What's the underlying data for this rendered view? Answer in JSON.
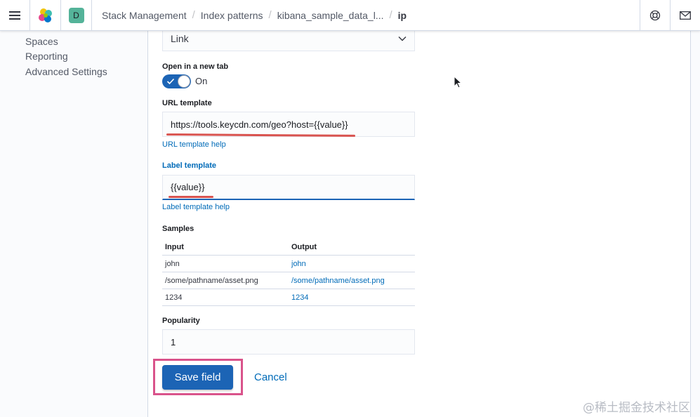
{
  "header": {
    "space_initial": "D",
    "breadcrumbs": [
      "Stack Management",
      "Index patterns",
      "kibana_sample_data_l...",
      "ip"
    ],
    "separator": "/"
  },
  "sidenav": {
    "items": [
      "Spaces",
      "Reporting",
      "Advanced Settings"
    ]
  },
  "form": {
    "select_value": "Link",
    "open_new_tab_label": "Open in a new tab",
    "open_new_tab_state": "On",
    "url_template_label": "URL template",
    "url_template_value": "https://tools.keycdn.com/geo?host={{value}}",
    "url_template_help": "URL template help",
    "label_template_label": "Label template",
    "label_template_value": "{{value}}",
    "label_template_help": "Label template help",
    "samples_label": "Samples",
    "samples_headers": [
      "Input",
      "Output"
    ],
    "samples_rows": [
      [
        "john",
        "john"
      ],
      [
        "/some/pathname/asset.png",
        "/some/pathname/asset.png"
      ],
      [
        "1234",
        "1234"
      ]
    ],
    "popularity_label": "Popularity",
    "popularity_value": "1",
    "save_label": "Save field",
    "cancel_label": "Cancel"
  },
  "watermark": "@稀土掘金技术社区",
  "colors": {
    "primary": "#1c64b5",
    "link": "#006bb8",
    "annotation_red": "#d9534f",
    "annotation_pink": "#d9538b"
  },
  "icons": [
    "menu-icon",
    "elastic-logo-icon",
    "help-icon",
    "mail-icon",
    "chevron-down-icon",
    "check-icon"
  ]
}
